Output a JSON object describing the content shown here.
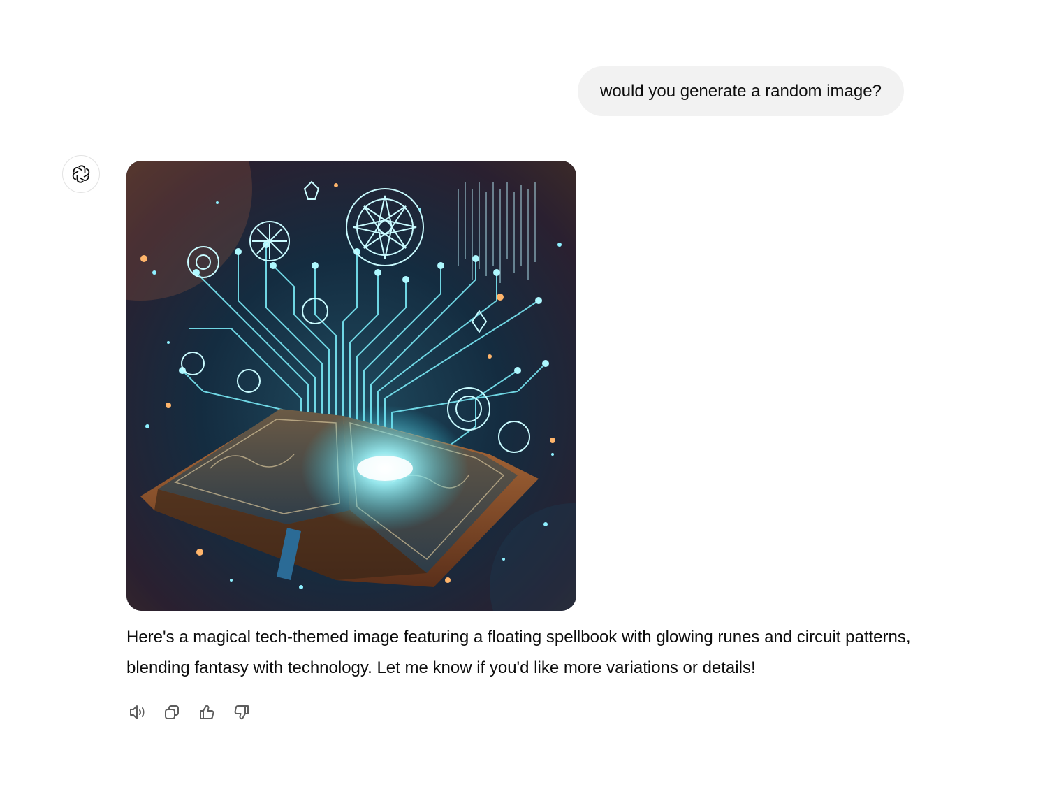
{
  "conversation": {
    "user_message": "would you generate a random image?",
    "assistant_text": "Here's a magical tech-themed image featuring a floating spellbook with glowing runes and circuit patterns, blending fantasy with technology. Let me know if you'd like more variations or details!",
    "assistant_avatar_icon": "openai-logo-icon",
    "image_subject_icon": "generated-spellbook-image"
  },
  "actions": [
    {
      "icon": "speaker-icon",
      "name": "read-aloud-button"
    },
    {
      "icon": "copy-icon",
      "name": "copy-button"
    },
    {
      "icon": "thumbs-up-icon",
      "name": "good-response-button"
    },
    {
      "icon": "thumbs-down-icon",
      "name": "bad-response-button"
    }
  ],
  "colors": {
    "user_bubble_bg": "#f2f2f2",
    "text": "#0d0d0d",
    "icon": "#5d5d5d",
    "image_glow": "#7ff3ff"
  }
}
